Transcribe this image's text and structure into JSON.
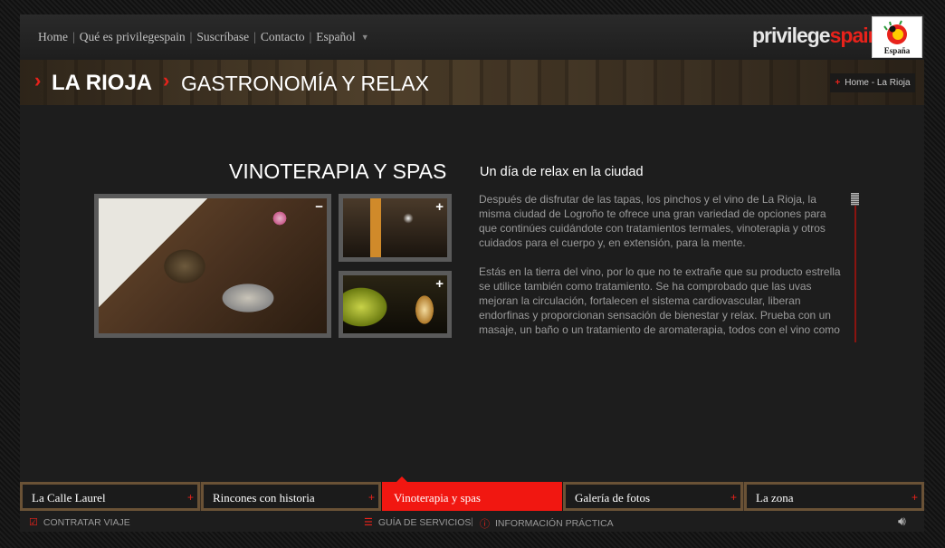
{
  "topnav": {
    "links": [
      "Home",
      "Qué es privilegespain",
      "Suscríbase",
      "Contacto",
      "Español"
    ],
    "language_caret_icon": "chevron-down-icon"
  },
  "brand": {
    "logo_part1": "privilege",
    "logo_part2": "spain",
    "partner_logo_icon": "spain-tourism-logo",
    "accent_color": "#e8221b"
  },
  "header": {
    "region": "LA RIOJA",
    "section": "GASTRONOMÍA Y RELAX",
    "breadcrumb": "Home - La Rioja"
  },
  "content": {
    "title": "VINOTERAPIA Y SPAS",
    "photos": [
      {
        "toggle": "−",
        "icon": "collapse-icon"
      },
      {
        "toggle": "+",
        "icon": "expand-icon"
      },
      {
        "toggle": "+",
        "icon": "expand-icon"
      }
    ],
    "article_heading": "Un día de relax en la ciudad",
    "paragraphs": [
      "Después de disfrutar de las tapas, los pinchos y el vino de La Rioja, la misma ciudad de Logroño te ofrece una gran variedad de opciones para que continúes cuidándote con tratamientos termales, vinoterapia y otros cuidados para el cuerpo y, en extensión, para la mente.",
      "Estás en la tierra del vino, por lo que no te extrañe que su producto estrella se utilice también como tratamiento. Se ha comprobado que las uvas mejoran la circulación, fortalecen el sistema cardiovascular, liberan endorfinas y proporcionan sensación de bienestar y relax. Prueba con un masaje, un baño o un tratamiento de aromaterapia, todos con el vino como"
    ]
  },
  "tabs": [
    {
      "label": "La Calle Laurel",
      "active": false
    },
    {
      "label": "Rincones con historia",
      "active": false
    },
    {
      "label": "Vinoterapia y spas",
      "active": true
    },
    {
      "label": "Galería de fotos",
      "active": false
    },
    {
      "label": "La zona",
      "active": false
    }
  ],
  "footer": {
    "contract": "CONTRATAR VIAJE",
    "services": "GUÍA DE SERVICIOS",
    "separator": "|",
    "info": "INFORMACIÓN PRÁCTICA",
    "sound_icon": "speaker-icon"
  }
}
